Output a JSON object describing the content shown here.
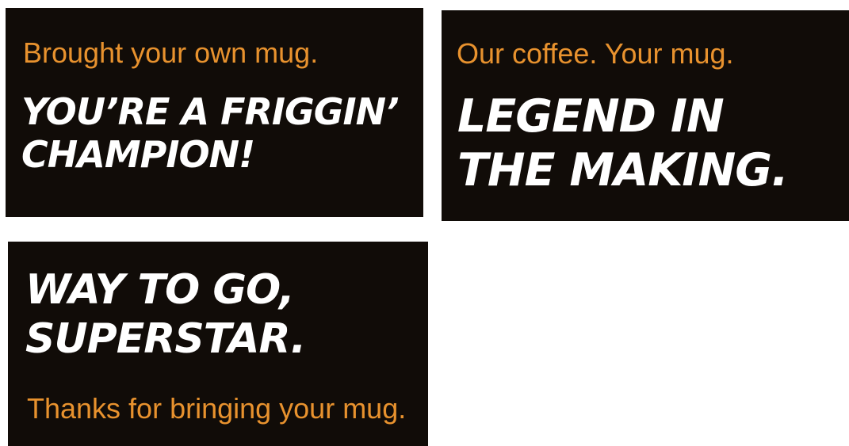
{
  "colors": {
    "background": "#ffffff",
    "card": "#110c08",
    "accent": "#e8922e",
    "headline": "#ffffff"
  },
  "cards": [
    {
      "subtitle": "Brought your own mug.",
      "headline_line1": "YOU’RE A FRIGGIN’",
      "headline_line2": "CHAMPION!"
    },
    {
      "subtitle": "Our coffee. Your mug.",
      "headline_line1": "LEGEND IN",
      "headline_line2": "THE MAKING."
    },
    {
      "headline_line1": "WAY TO GO,",
      "headline_line2": "SUPERSTAR.",
      "subtitle": "Thanks for bringing your mug."
    }
  ]
}
